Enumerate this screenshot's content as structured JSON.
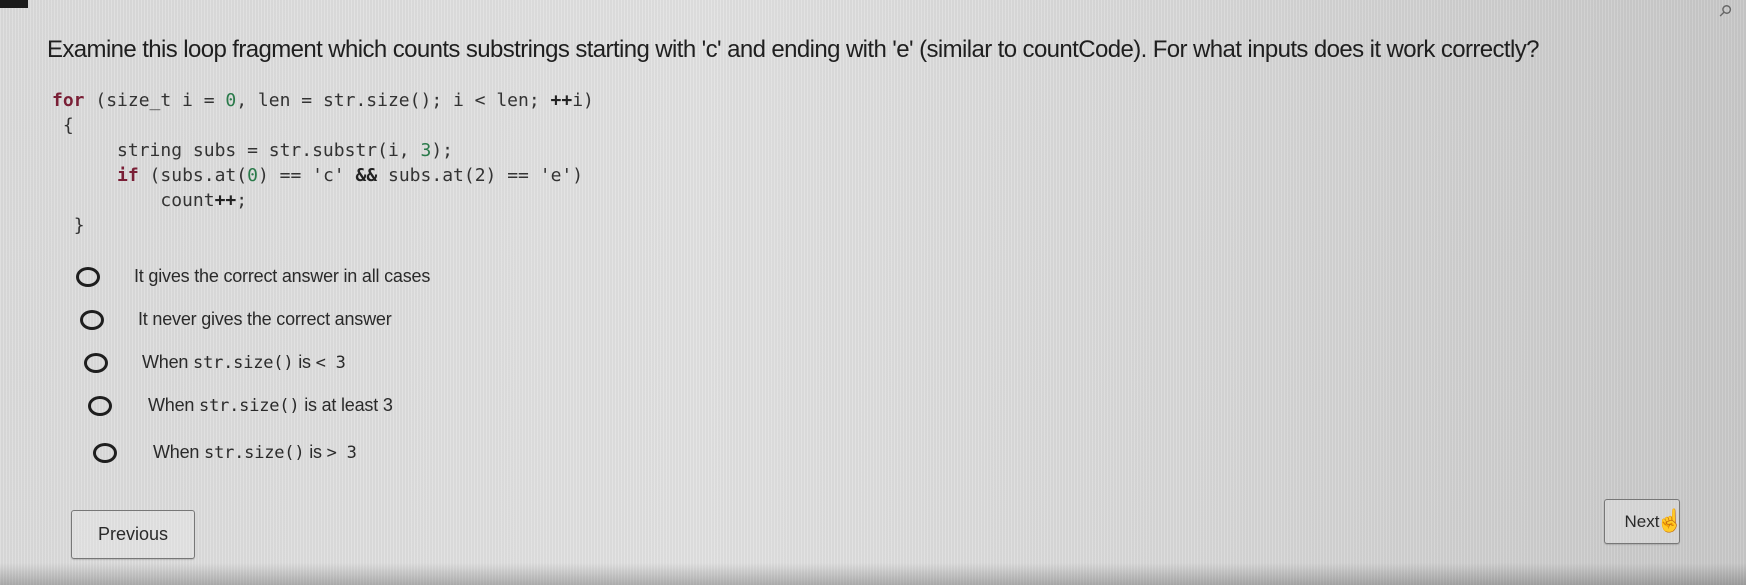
{
  "question": {
    "text": "Examine this loop fragment which counts substrings starting with 'c' and ending with 'e' (similar to countCode). For what inputs does it work correctly?"
  },
  "code": {
    "line1": {
      "kw": "for",
      "rest_a": " (size_t i = ",
      "num": "0",
      "rest_b": ", len = str.size(); i < len; ",
      "op": "++",
      "rest_c": "i)"
    },
    "line2": "{",
    "line3": {
      "text_a": "string subs = str.substr(i, ",
      "num": "3",
      "text_b": ");"
    },
    "line4": {
      "kw": "if",
      "text_a": " (subs.at(",
      "num0": "0",
      "text_b": ") == 'c' ",
      "op": "&&",
      "text_c": " subs.at(2) == 'e')"
    },
    "line5": {
      "text": "count",
      "op": "++",
      "end": ";"
    },
    "line6": "}"
  },
  "options": [
    {
      "label": "It gives the correct answer in all cases",
      "selected": false
    },
    {
      "label": "It never gives the correct answer",
      "selected": false
    },
    {
      "prefix": "When ",
      "code": "str.size()",
      "suffix": " is ",
      "code2": "< 3",
      "selected": false
    },
    {
      "prefix": "When ",
      "code": "str.size()",
      "suffix": " is at least 3",
      "selected": false
    },
    {
      "prefix": "When ",
      "code": "str.size()",
      "suffix": " is ",
      "code2": "> 3",
      "selected": false
    }
  ],
  "nav": {
    "previous_label": "Previous",
    "next_label": "Next"
  },
  "icons": {
    "pin": "pin-icon",
    "cursor": "hand-pointer-icon"
  }
}
